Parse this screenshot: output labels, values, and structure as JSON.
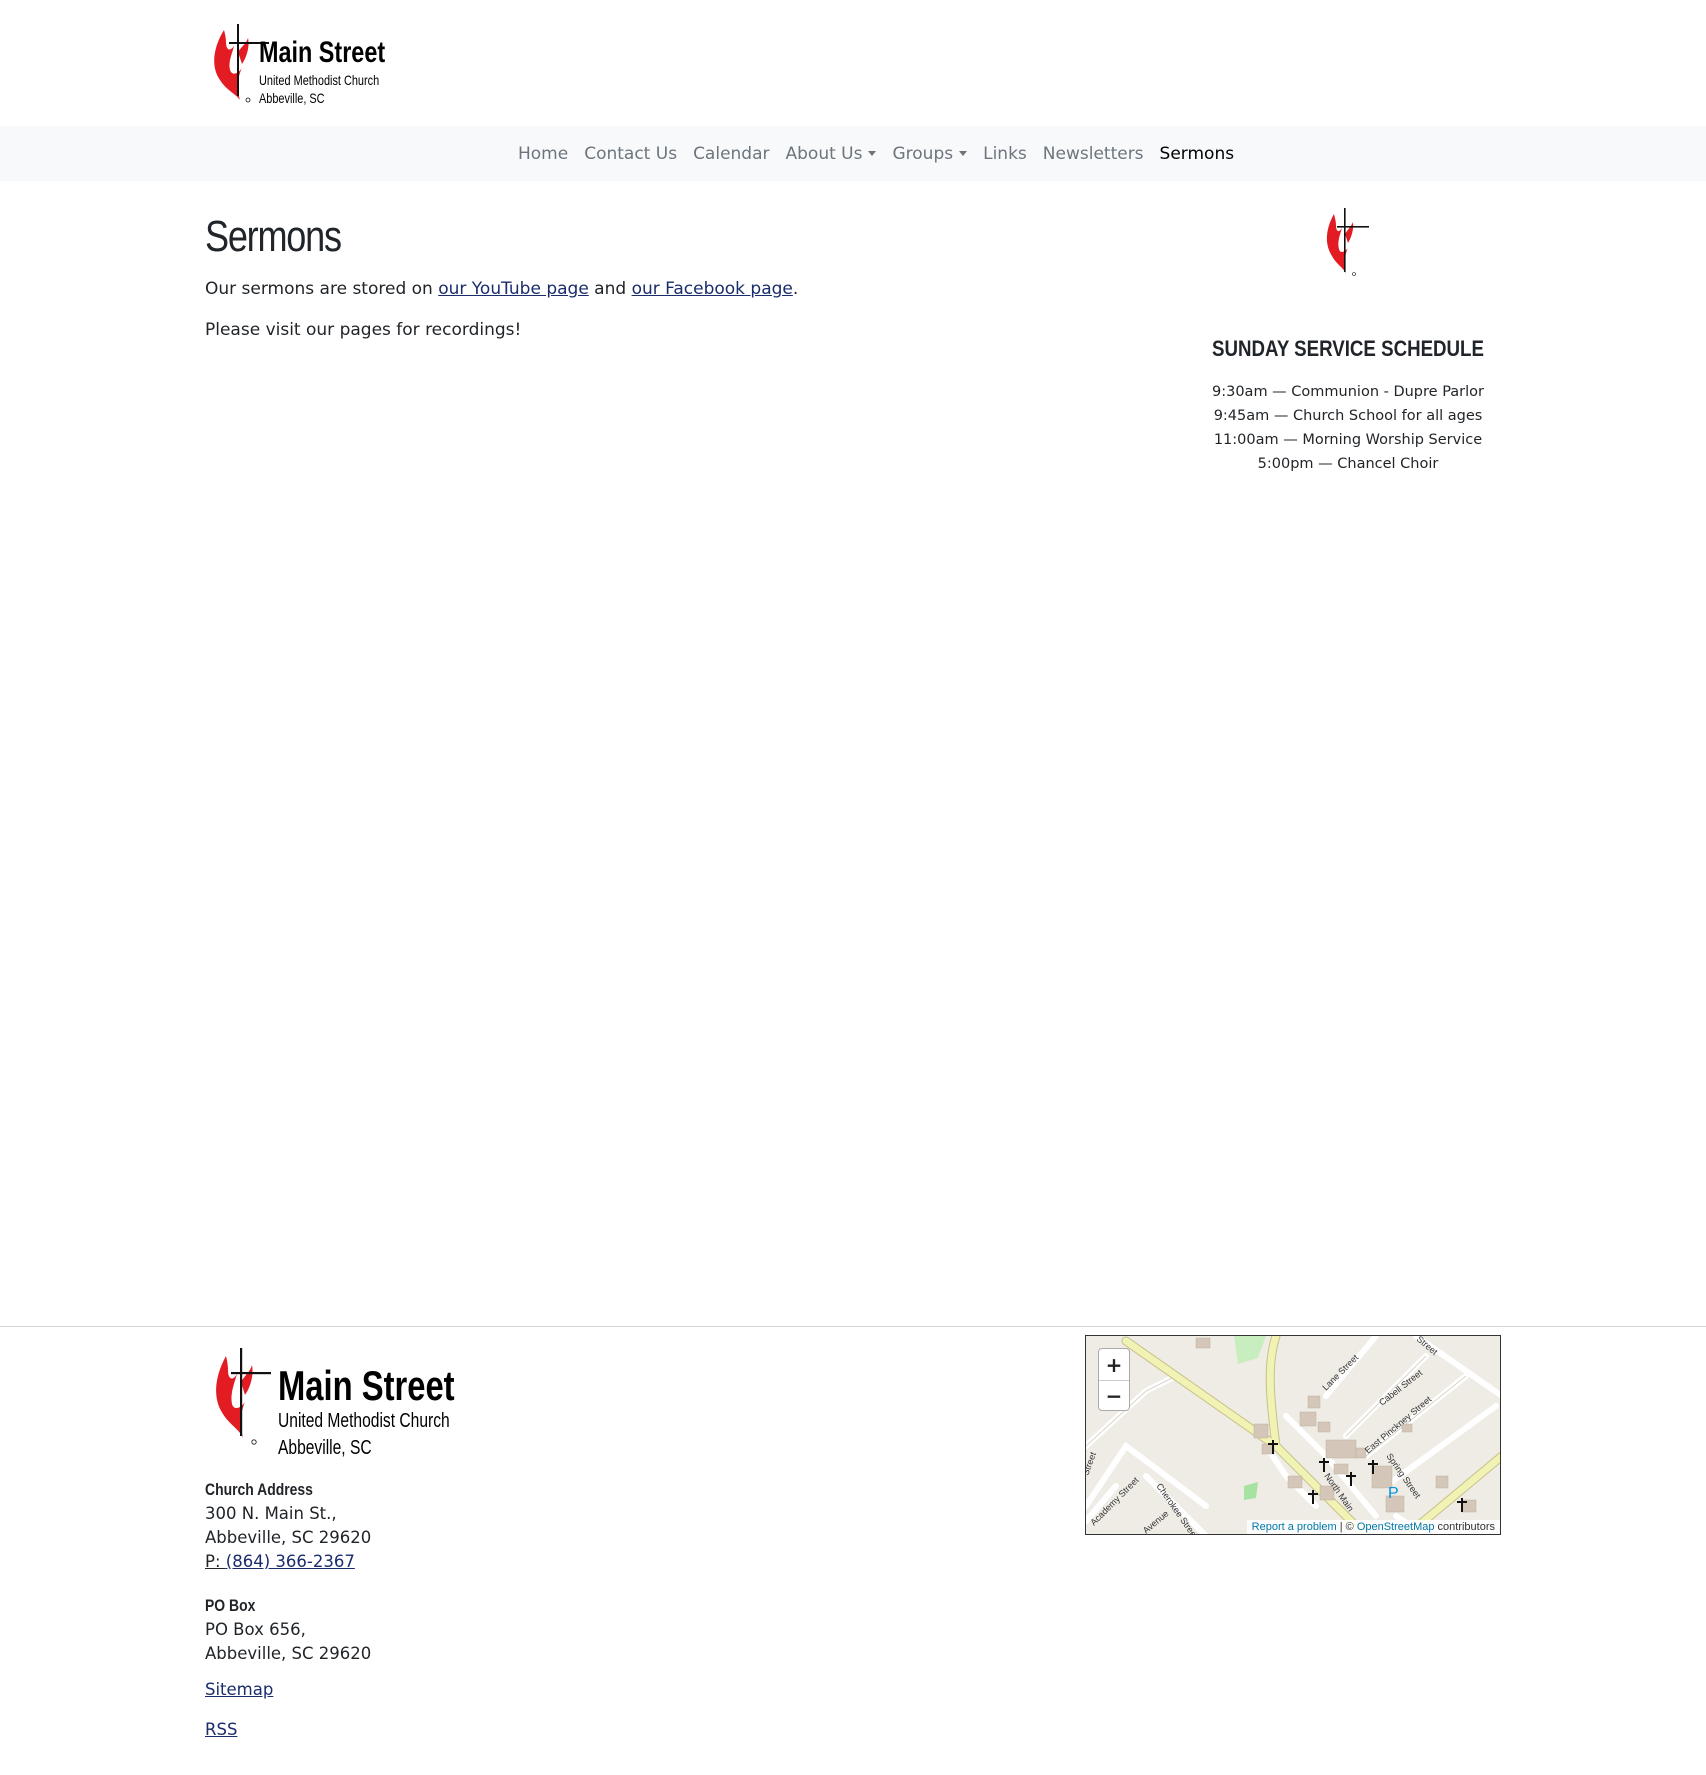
{
  "site": {
    "logo": {
      "title": "Main Street",
      "subtitle": "United Methodist Church",
      "location": "Abbeville, SC"
    }
  },
  "nav": {
    "items": [
      {
        "label": "Home",
        "dropdown": false,
        "active": false
      },
      {
        "label": "Contact Us",
        "dropdown": false,
        "active": false
      },
      {
        "label": "Calendar",
        "dropdown": false,
        "active": false
      },
      {
        "label": "About Us",
        "dropdown": true,
        "active": false
      },
      {
        "label": "Groups",
        "dropdown": true,
        "active": false
      },
      {
        "label": "Links",
        "dropdown": false,
        "active": false
      },
      {
        "label": "Newsletters",
        "dropdown": false,
        "active": false
      },
      {
        "label": "Sermons",
        "dropdown": false,
        "active": true
      }
    ]
  },
  "main": {
    "title": "Sermons",
    "p1_before": "Our sermons are stored on ",
    "youtube_link": "our YouTube page",
    "p1_middle": " and ",
    "facebook_link": "our Facebook page",
    "p1_after": ".",
    "p2": "Please visit our pages for recordings!"
  },
  "sidebar": {
    "schedule_title": "SUNDAY SERVICE SCHEDULE",
    "schedule": [
      "9:30am — Communion - Dupre Parlor",
      "9:45am — Church School for all ages",
      "11:00am — Morning Worship Service",
      "5:00pm — Chancel Choir"
    ]
  },
  "footer": {
    "address_heading": "Church Address",
    "address_line1": "300 N. Main St.,",
    "address_line2": "Abbeville, SC 29620",
    "phone_prefix": "P: ",
    "phone": "(864) 366-2367",
    "pobox_heading": "PO Box",
    "pobox_line1": "PO Box 656,",
    "pobox_line2": "Abbeville, SC 29620",
    "sitemap": "Sitemap",
    "rss": "RSS"
  },
  "map": {
    "zoom_in": "+",
    "zoom_out": "−",
    "report": "Report a problem",
    "separator": " | © ",
    "osm": "OpenStreetMap",
    "contributors": " contributors",
    "street_labels": [
      "Lane Street",
      "Cabell Street",
      "East Pinckney Street",
      "Spring Street",
      "North Main",
      "Cherokee Street",
      "Academy Street",
      "Avenue",
      "Street",
      "Street"
    ],
    "parking_label": "P"
  },
  "colors": {
    "flame_red": "#e31b23",
    "link": "#1a2c6b",
    "nav_bg": "#f8f9fa",
    "nav_text": "#6c757d"
  }
}
